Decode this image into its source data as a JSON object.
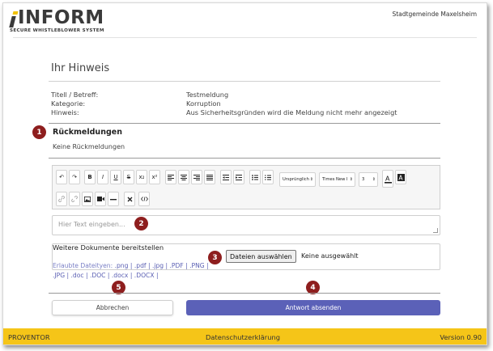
{
  "header": {
    "logo_text": "INFORM",
    "logo_tagline": "SECURE WHISTLEBLOWER SYSTEM",
    "organization": "Stadtgemeinde Maxelsheim"
  },
  "report": {
    "heading": "Ihr Hinweis",
    "fields": [
      {
        "label": "Titell / Betreff:",
        "value": "Testmeldung"
      },
      {
        "label": "Kategorie:",
        "value": "Korruption"
      },
      {
        "label": "Hinweis:",
        "value": "Aus Sicherheitsgründen wird die Meldung nicht mehr angezeigt"
      }
    ]
  },
  "feedback": {
    "heading": "Rückmeldungen",
    "empty_text": "Keine Rückmeldungen"
  },
  "editor": {
    "toolbar_row1": [
      "↶",
      "↷",
      "B",
      "I",
      "U",
      "S",
      "x₂",
      "x²"
    ],
    "paragraph_select": "Ursprünglich",
    "font_select": "Times New I",
    "size_select": "3",
    "placeholder": "Hier Text eingeben..."
  },
  "documents": {
    "heading": "Weitere Dokumente bereitstellen",
    "allowed_label": "Erlaubte Dateityen:",
    "allowed_types": ".png | .pdf | .jpg | .PDF | .PNG | .JPG | .doc | .DOC | .docx | .DOCX |",
    "choose_button": "Dateien auswählen",
    "no_file": "Keine ausgewählt"
  },
  "actions": {
    "cancel": "Abbrechen",
    "submit": "Antwort absenden"
  },
  "badges": [
    "1",
    "2",
    "3",
    "4",
    "5"
  ],
  "footer": {
    "left": "PROVENTOR",
    "center": "Datenschutzerklärung",
    "right": "Version 0.90"
  },
  "colors": {
    "accent_yellow": "#f5c518",
    "primary_button": "#5b61b8",
    "badge": "#8e1e1e"
  }
}
